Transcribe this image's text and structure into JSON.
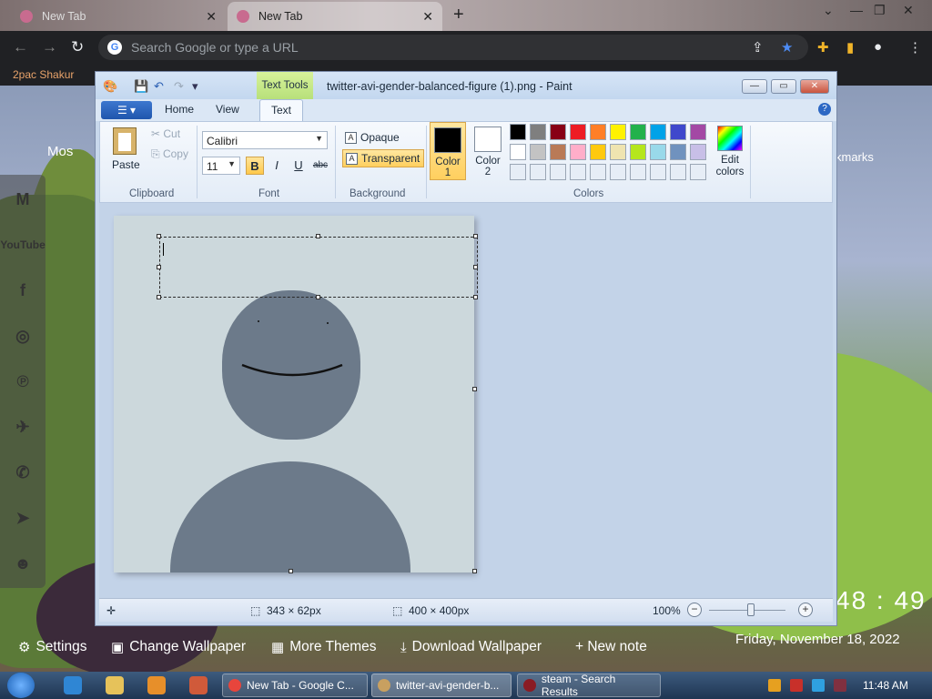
{
  "browser": {
    "tabs": [
      {
        "label": "New Tab"
      },
      {
        "label": "New Tab"
      }
    ],
    "omnibox_placeholder": "Search Google or type a URL",
    "bookmark": "2pac Shakur"
  },
  "ntp": {
    "most_visited": "Mos",
    "bookmarks_label": "kmarks",
    "clock": "48 : 49",
    "date": "Friday, November 18, 2022",
    "bottom": {
      "settings": "Settings",
      "change_wallpaper": "Change Wallpaper",
      "more_themes": "More Themes",
      "download_wallpaper": "Download Wallpaper",
      "new_note": "+ New note"
    },
    "side_icons": [
      "gmail-icon",
      "youtube-icon",
      "facebook-icon",
      "instagram-icon",
      "pinterest-icon",
      "twitter-icon",
      "whatsapp-icon",
      "telegram-icon",
      "reddit-icon"
    ],
    "youtube_label": "YouTube"
  },
  "paint": {
    "context_tab": "Text Tools",
    "title": "twitter-avi-gender-balanced-figure (1).png - Paint",
    "tabs": {
      "home": "Home",
      "view": "View",
      "text": "Text"
    },
    "clipboard": {
      "paste": "Paste",
      "cut": "Cut",
      "copy": "Copy",
      "label": "Clipboard"
    },
    "font": {
      "family": "Calibri",
      "size": "11",
      "bold": "B",
      "italic": "I",
      "underline": "U",
      "strike": "abc",
      "label": "Font"
    },
    "background": {
      "opaque": "Opaque",
      "transparent": "Transparent",
      "label": "Background"
    },
    "colors": {
      "color1": "Color\n1",
      "color1_a": "Color",
      "color1_b": "1",
      "color2_a": "Color",
      "color2_b": "2",
      "edit_a": "Edit",
      "edit_b": "colors",
      "label": "Colors",
      "row1": [
        "#000000",
        "#7f7f7f",
        "#880015",
        "#ed1c24",
        "#ff7f27",
        "#fff200",
        "#22b14c",
        "#00a2e8",
        "#3f48cc",
        "#a349a4"
      ],
      "row2": [
        "#ffffff",
        "#c3c3c3",
        "#b97a57",
        "#ffaec9",
        "#ffc90e",
        "#efe4b0",
        "#b5e61d",
        "#99d9ea",
        "#7092be",
        "#c8bfe7"
      ]
    },
    "status": {
      "selection": "343 × 62px",
      "image_size": "400 × 400px",
      "zoom": "100%"
    }
  },
  "taskbar": {
    "items": [
      {
        "label": "New Tab - Google C..."
      },
      {
        "label": "twitter-avi-gender-b..."
      },
      {
        "label": "steam - Search Results"
      }
    ],
    "time": "11:48 AM"
  }
}
